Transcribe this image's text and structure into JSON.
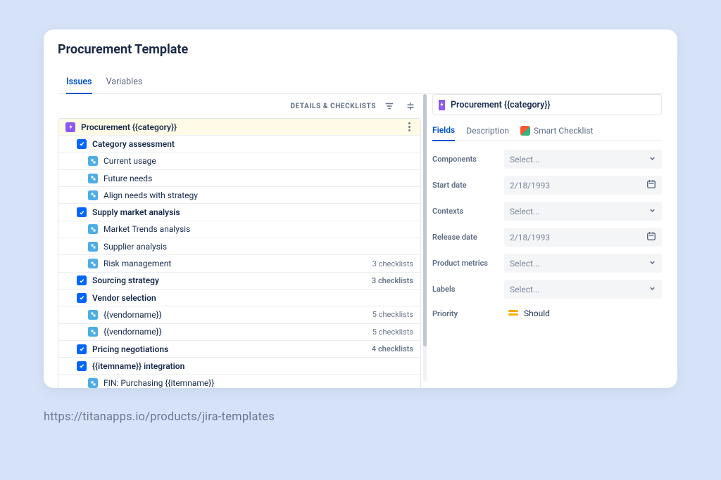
{
  "page": {
    "title": "Procurement Template"
  },
  "main_tabs": {
    "active": "Issues",
    "other": "Variables"
  },
  "toolbar": {
    "label": "DETAILS & CHECKLISTS"
  },
  "rows": [
    {
      "level": 0,
      "iconType": "epic",
      "label": "Procurement {{category}}",
      "meta": "",
      "kebab": true
    },
    {
      "level": 1,
      "iconType": "check",
      "label": "Category assessment"
    },
    {
      "level": 2,
      "iconType": "sub",
      "label": "Current usage"
    },
    {
      "level": 2,
      "iconType": "sub",
      "label": "Future needs"
    },
    {
      "level": 2,
      "iconType": "sub",
      "label": "Align needs with strategy"
    },
    {
      "level": 1,
      "iconType": "check",
      "label": "Supply market analysis"
    },
    {
      "level": 2,
      "iconType": "sub",
      "label": "Market Trends analysis"
    },
    {
      "level": 2,
      "iconType": "sub",
      "label": "Supplier analysis"
    },
    {
      "level": 2,
      "iconType": "sub",
      "label": "Risk management",
      "meta": "3 checklists"
    },
    {
      "level": 1,
      "iconType": "check",
      "label": "Sourcing strategy",
      "meta": "3 checklists"
    },
    {
      "level": 1,
      "iconType": "check",
      "label": "Vendor selection"
    },
    {
      "level": 2,
      "iconType": "sub",
      "label": "{{vendorname}}",
      "meta": "5 checklists"
    },
    {
      "level": 2,
      "iconType": "sub",
      "label": "{{vendorname}}",
      "meta": "5 checklists"
    },
    {
      "level": 1,
      "iconType": "check",
      "label": "Pricing negotiations",
      "meta": "4 checklists"
    },
    {
      "level": 1,
      "iconType": "check",
      "label": "{{itemname}} integration"
    },
    {
      "level": 2,
      "iconType": "sub",
      "label": "FIN: Purchasing {{itemname}}"
    }
  ],
  "panel": {
    "title": "Procurement {{category}}",
    "tabs": {
      "t1": "Fields",
      "t2": "Description",
      "t3": "Smart Checklist"
    },
    "fields": [
      {
        "label": "Components",
        "value": "Select...",
        "type": "select"
      },
      {
        "label": "Start date",
        "value": "2/18/1993",
        "type": "date"
      },
      {
        "label": "Contexts",
        "value": "Select...",
        "type": "select"
      },
      {
        "label": "Release date",
        "value": "2/18/1993",
        "type": "date"
      },
      {
        "label": "Product metrics",
        "value": "Select...",
        "type": "select"
      },
      {
        "label": "Labels",
        "value": "Select...",
        "type": "select"
      }
    ],
    "priority": {
      "label": "Priority",
      "value": "Should"
    }
  },
  "caption": "https://titanapps.io/products/jira-templates"
}
